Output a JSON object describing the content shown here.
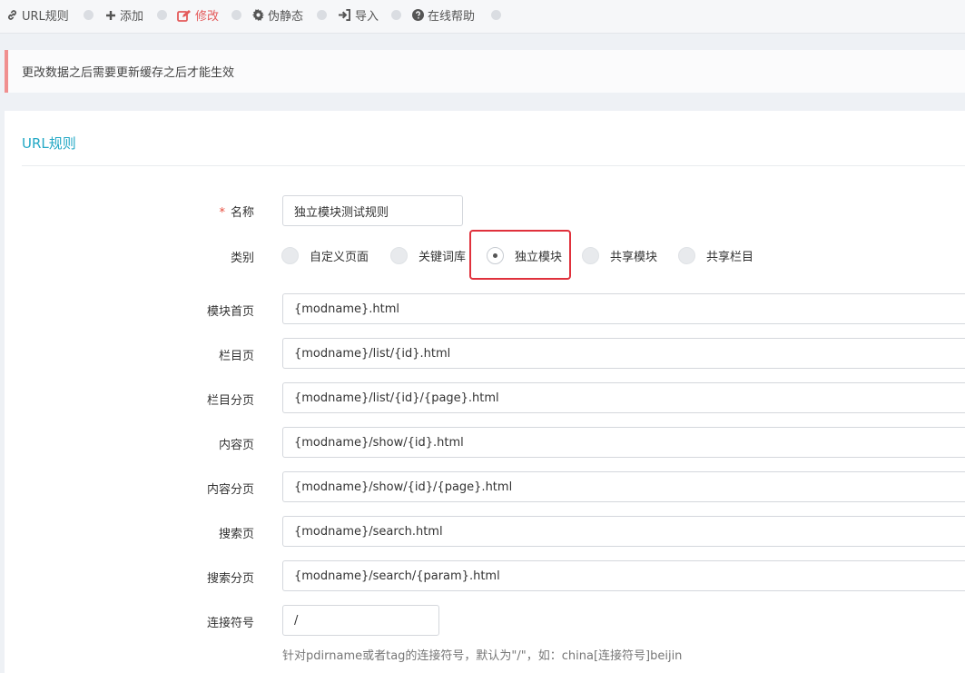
{
  "toolbar": {
    "items": [
      {
        "label": "URL规则",
        "icon": "link-icon"
      },
      {
        "label": "添加",
        "icon": "plus-icon"
      },
      {
        "label": "修改",
        "icon": "edit-icon",
        "active": true
      },
      {
        "label": "伪静态",
        "icon": "gear-icon"
      },
      {
        "label": "导入",
        "icon": "sign-in-icon"
      },
      {
        "label": "在线帮助",
        "icon": "question-circle-icon"
      }
    ],
    "active_color": "#e45a5a"
  },
  "notice": {
    "text": "更改数据之后需要更新缓存之后才能生效"
  },
  "panel": {
    "title": "URL规则"
  },
  "form": {
    "name": {
      "label": "名称",
      "required_mark": "*",
      "value": "独立模块测试规则"
    },
    "category": {
      "label": "类别",
      "options": [
        "自定义页面",
        "关键词库",
        "独立模块",
        "共享模块",
        "共享栏目"
      ],
      "selected": "独立模块"
    },
    "fields": [
      {
        "label": "模块首页",
        "value": "{modname}.html"
      },
      {
        "label": "栏目页",
        "value": "{modname}/list/{id}.html"
      },
      {
        "label": "栏目分页",
        "value": "{modname}/list/{id}/{page}.html"
      },
      {
        "label": "内容页",
        "value": "{modname}/show/{id}.html"
      },
      {
        "label": "内容分页",
        "value": "{modname}/show/{id}/{page}.html"
      },
      {
        "label": "搜索页",
        "value": "{modname}/search.html"
      },
      {
        "label": "搜索分页",
        "value": "{modname}/search/{param}.html"
      }
    ],
    "separator": {
      "label": "连接符号",
      "value": "/",
      "help": "针对pdirname或者tag的连接符号，默认为\"/\"，如：china[连接符号]beijin"
    }
  },
  "colors": {
    "accent": "#22a8c5",
    "highlight_border": "#e0313c",
    "notice_border": "#f08f8f"
  }
}
